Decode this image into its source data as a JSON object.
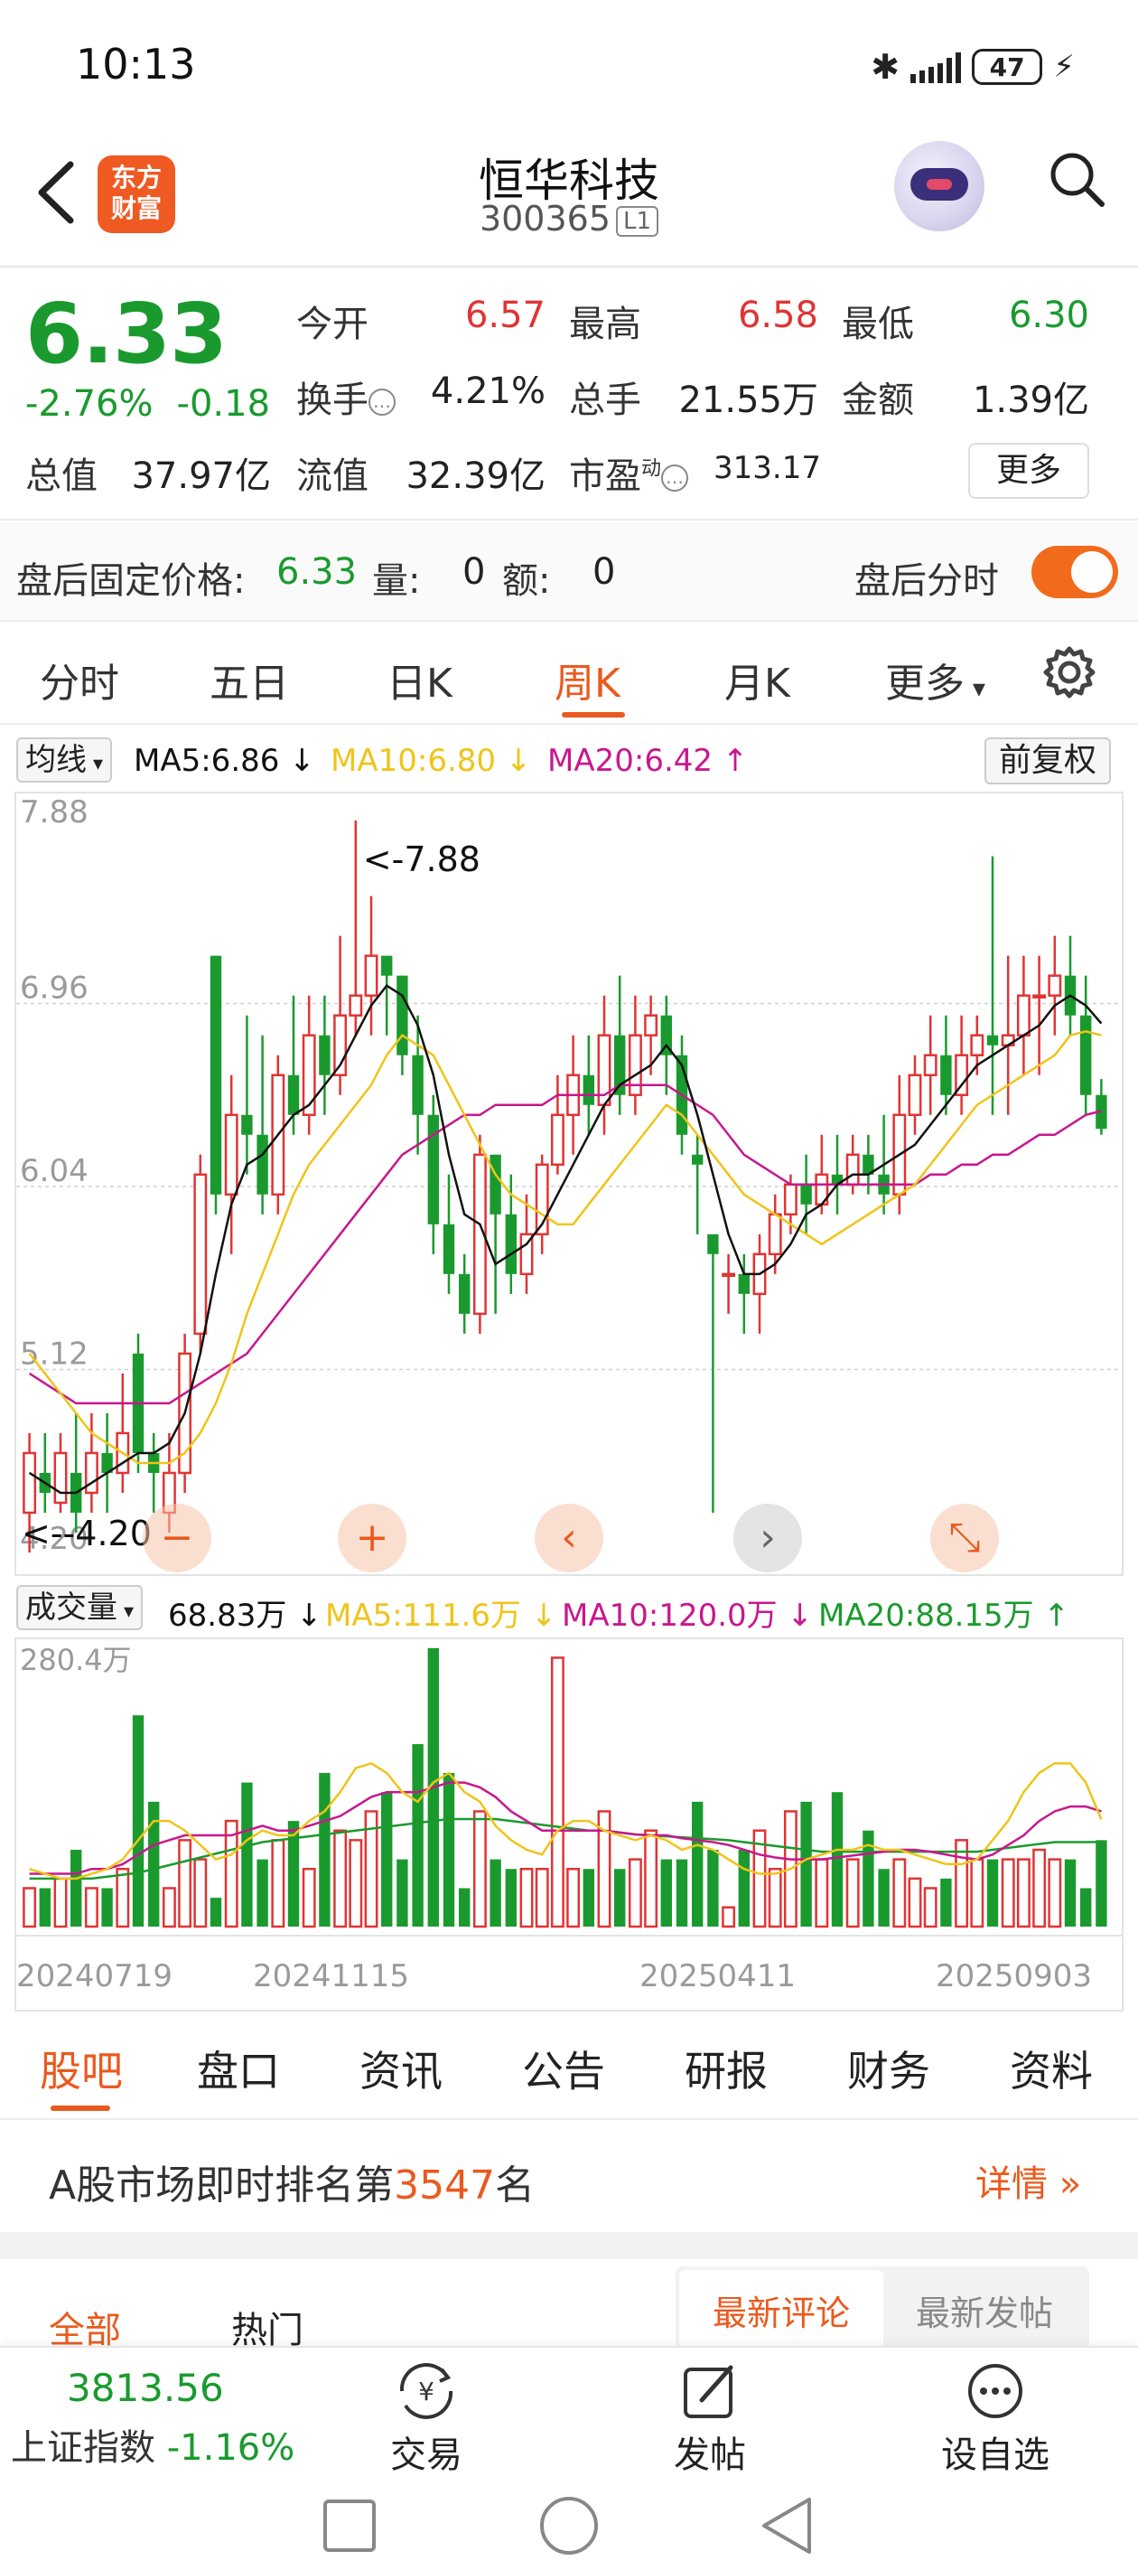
{
  "status_bar": {
    "time": "10:13",
    "battery": "47"
  },
  "header": {
    "title": "恒华科技",
    "code": "300365",
    "board_badge": "L1",
    "logo_text_line1": "东方",
    "logo_text_line2": "财富"
  },
  "quote": {
    "price": "6.33",
    "change_pct": "-2.76%",
    "change_abs": "-0.18",
    "open_label": "今开",
    "open_value": "6.57",
    "high_label": "最高",
    "high_value": "6.58",
    "low_label": "最低",
    "low_value": "6.30",
    "turnover_label": "换手",
    "turnover_value": "4.21%",
    "volume_label": "总手",
    "volume_value": "21.55万",
    "amount_label": "金额",
    "amount_value": "1.39亿",
    "mktcap_label": "总值",
    "mktcap_value": "37.97亿",
    "float_label": "流值",
    "float_value": "32.39亿",
    "pe_label": "市盈",
    "pe_sup": "动",
    "pe_value": "313.17",
    "more_button": "更多"
  },
  "after_hours": {
    "label": "盘后固定价格:",
    "price": "6.33",
    "vol_label": "量:",
    "vol_value": "0",
    "amt_label": "额:",
    "amt_value": "0",
    "toggle_label": "盘后分时",
    "toggle_on": true
  },
  "period_tabs": [
    "分时",
    "五日",
    "日K",
    "周K",
    "月K",
    "更多"
  ],
  "active_period": "周K",
  "ma_bar": {
    "selector": "均线",
    "ma5": "MA5:6.86",
    "ma10": "MA10:6.80",
    "ma20": "MA20:6.42",
    "adjust": "前复权"
  },
  "volume_bar": {
    "selector": "成交量",
    "vol": "68.83万",
    "ma5": "MA5:111.6万",
    "ma10": "MA10:120.0万",
    "ma20": "MA20:88.15万"
  },
  "colors": {
    "up": "#e03434",
    "down": "#1a9a2e",
    "ma5_line": "#111111",
    "ma10_line": "#f0c419",
    "ma20_line": "#c8178e",
    "accent": "#ea5a1e"
  },
  "chart_data": [
    {
      "type": "candlestick",
      "title": "",
      "y_ticks": [
        "7.88",
        "6.96",
        "6.04",
        "5.12",
        "4.20"
      ],
      "ylim": [
        4.2,
        7.88
      ],
      "high_marker": "<-7.88",
      "low_marker": "<--4.20",
      "candles": [
        [
          4.4,
          4.7,
          4.2,
          4.8
        ],
        [
          4.6,
          4.5,
          4.4,
          4.8
        ],
        [
          4.45,
          4.7,
          4.4,
          4.8
        ],
        [
          4.6,
          4.4,
          4.3,
          4.9
        ],
        [
          4.5,
          4.7,
          4.4,
          4.9
        ],
        [
          4.7,
          4.6,
          4.4,
          4.9
        ],
        [
          4.6,
          4.8,
          4.5,
          5.1
        ],
        [
          5.2,
          4.7,
          4.6,
          5.3
        ],
        [
          4.7,
          4.6,
          4.4,
          4.8
        ],
        [
          4.4,
          4.6,
          4.3,
          4.8
        ],
        [
          4.6,
          5.2,
          4.5,
          5.3
        ],
        [
          5.3,
          6.1,
          5.2,
          6.2
        ],
        [
          7.2,
          6.0,
          5.9,
          7.2
        ],
        [
          6.0,
          6.4,
          5.7,
          6.6
        ],
        [
          6.4,
          6.3,
          6.1,
          6.9
        ],
        [
          6.3,
          6.0,
          5.9,
          6.8
        ],
        [
          6.0,
          6.6,
          5.9,
          6.7
        ],
        [
          6.6,
          6.4,
          6.3,
          7.0
        ],
        [
          6.4,
          6.8,
          6.3,
          7.0
        ],
        [
          6.8,
          6.6,
          6.4,
          7.0
        ],
        [
          6.6,
          6.9,
          6.5,
          7.3
        ],
        [
          6.9,
          7.0,
          6.8,
          7.88
        ],
        [
          7.0,
          7.2,
          6.8,
          7.5
        ],
        [
          7.2,
          7.1,
          6.8,
          7.2
        ],
        [
          7.1,
          6.7,
          6.6,
          7.1
        ],
        [
          6.7,
          6.4,
          6.2,
          6.9
        ],
        [
          6.4,
          5.85,
          5.7,
          6.5
        ],
        [
          5.85,
          5.6,
          5.5,
          6.1
        ],
        [
          5.6,
          5.4,
          5.3,
          5.7
        ],
        [
          5.4,
          6.2,
          5.3,
          6.3
        ],
        [
          6.2,
          5.9,
          5.4,
          6.2
        ],
        [
          5.9,
          5.6,
          5.5,
          6.1
        ],
        [
          5.6,
          5.8,
          5.5,
          6.0
        ],
        [
          5.8,
          6.15,
          5.7,
          6.2
        ],
        [
          6.15,
          6.4,
          6.1,
          6.6
        ],
        [
          6.4,
          6.6,
          6.2,
          6.8
        ],
        [
          6.6,
          6.45,
          6.3,
          6.8
        ],
        [
          6.45,
          6.8,
          6.3,
          7.0
        ],
        [
          6.8,
          6.5,
          6.4,
          7.1
        ],
        [
          6.5,
          6.8,
          6.4,
          7.0
        ],
        [
          6.8,
          6.9,
          6.6,
          7.0
        ],
        [
          6.9,
          6.7,
          6.5,
          7.0
        ],
        [
          6.7,
          6.3,
          6.2,
          6.8
        ],
        [
          6.2,
          6.15,
          5.8,
          6.3
        ],
        [
          5.8,
          5.7,
          4.4,
          5.8
        ],
        [
          5.6,
          5.6,
          5.4,
          5.7
        ],
        [
          5.6,
          5.5,
          5.3,
          5.7
        ],
        [
          5.5,
          5.7,
          5.3,
          5.8
        ],
        [
          5.7,
          5.9,
          5.6,
          6.0
        ],
        [
          5.9,
          6.05,
          5.8,
          6.1
        ],
        [
          6.05,
          5.95,
          5.8,
          6.2
        ],
        [
          5.95,
          6.1,
          5.9,
          6.3
        ],
        [
          6.1,
          6.05,
          5.9,
          6.3
        ],
        [
          6.05,
          6.2,
          6.0,
          6.3
        ],
        [
          6.2,
          6.1,
          6.0,
          6.3
        ],
        [
          6.1,
          6.0,
          5.9,
          6.4
        ],
        [
          6.0,
          6.4,
          5.9,
          6.6
        ],
        [
          6.4,
          6.6,
          6.3,
          6.7
        ],
        [
          6.6,
          6.7,
          6.4,
          6.9
        ],
        [
          6.7,
          6.5,
          6.4,
          6.9
        ],
        [
          6.5,
          6.7,
          6.4,
          6.9
        ],
        [
          6.7,
          6.8,
          6.6,
          6.9
        ],
        [
          6.8,
          6.75,
          6.4,
          7.7
        ],
        [
          6.75,
          6.8,
          6.4,
          7.2
        ],
        [
          6.8,
          7.0,
          6.6,
          7.2
        ],
        [
          7.0,
          7.0,
          6.6,
          7.2
        ],
        [
          7.0,
          7.1,
          6.8,
          7.3
        ],
        [
          7.1,
          6.9,
          6.8,
          7.3
        ],
        [
          6.9,
          6.5,
          6.4,
          7.1
        ],
        [
          6.5,
          6.33,
          6.3,
          6.58
        ]
      ],
      "ma5": [
        4.6,
        4.55,
        4.5,
        4.5,
        4.55,
        4.6,
        4.65,
        4.7,
        4.7,
        4.75,
        4.9,
        5.2,
        5.6,
        5.95,
        6.15,
        6.2,
        6.3,
        6.4,
        6.45,
        6.55,
        6.65,
        6.8,
        6.95,
        7.05,
        7.0,
        6.85,
        6.6,
        6.2,
        5.9,
        5.85,
        5.65,
        5.7,
        5.75,
        5.85,
        6.0,
        6.15,
        6.3,
        6.45,
        6.55,
        6.6,
        6.65,
        6.75,
        6.65,
        6.4,
        6.1,
        5.8,
        5.6,
        5.6,
        5.65,
        5.75,
        5.9,
        5.95,
        6.05,
        6.1,
        6.1,
        6.15,
        6.2,
        6.25,
        6.35,
        6.45,
        6.55,
        6.65,
        6.7,
        6.75,
        6.8,
        6.85,
        6.95,
        7.0,
        6.95,
        6.86
      ],
      "ma10": [
        5.2,
        5.1,
        5.0,
        4.9,
        4.8,
        4.75,
        4.7,
        4.65,
        4.65,
        4.65,
        4.7,
        4.8,
        4.95,
        5.15,
        5.4,
        5.6,
        5.8,
        6.0,
        6.15,
        6.25,
        6.35,
        6.45,
        6.55,
        6.7,
        6.8,
        6.75,
        6.7,
        6.55,
        6.4,
        6.25,
        6.1,
        6.0,
        5.95,
        5.9,
        5.85,
        5.85,
        5.95,
        6.05,
        6.15,
        6.25,
        6.35,
        6.45,
        6.4,
        6.3,
        6.2,
        6.1,
        6.0,
        5.95,
        5.9,
        5.85,
        5.8,
        5.75,
        5.8,
        5.85,
        5.9,
        5.95,
        6.0,
        6.05,
        6.15,
        6.25,
        6.35,
        6.45,
        6.5,
        6.55,
        6.6,
        6.65,
        6.7,
        6.8,
        6.82,
        6.8
      ],
      "ma20": [
        5.1,
        5.05,
        5.0,
        4.95,
        4.95,
        4.95,
        4.95,
        4.95,
        4.95,
        4.95,
        5.0,
        5.05,
        5.1,
        5.15,
        5.2,
        5.3,
        5.4,
        5.5,
        5.6,
        5.7,
        5.8,
        5.9,
        6.0,
        6.1,
        6.2,
        6.25,
        6.3,
        6.35,
        6.4,
        6.4,
        6.45,
        6.45,
        6.45,
        6.45,
        6.5,
        6.5,
        6.5,
        6.5,
        6.55,
        6.55,
        6.55,
        6.55,
        6.5,
        6.45,
        6.4,
        6.3,
        6.2,
        6.15,
        6.1,
        6.05,
        6.05,
        6.05,
        6.05,
        6.05,
        6.05,
        6.05,
        6.05,
        6.05,
        6.1,
        6.1,
        6.15,
        6.15,
        6.2,
        6.2,
        6.25,
        6.3,
        6.3,
        6.35,
        6.4,
        6.42
      ]
    },
    {
      "type": "bar",
      "title": "",
      "y_max_label": "280.4万",
      "ylim": [
        0,
        280.4
      ],
      "x_labels": [
        "20240719",
        "20241115",
        "20250411",
        "20250903"
      ],
      "volumes": [
        40,
        40,
        50,
        80,
        40,
        40,
        60,
        220,
        130,
        40,
        90,
        70,
        30,
        110,
        150,
        70,
        90,
        110,
        60,
        160,
        100,
        90,
        120,
        140,
        70,
        190,
        290,
        160,
        40,
        120,
        70,
        60,
        60,
        60,
        280,
        60,
        60,
        120,
        60,
        70,
        100,
        70,
        70,
        130,
        80,
        20,
        80,
        100,
        60,
        120,
        130,
        70,
        140,
        70,
        100,
        60,
        70,
        50,
        40,
        50,
        90,
        70,
        70,
        70,
        70,
        80,
        70,
        70,
        40,
        90
      ],
      "vol_ma5": [
        60,
        55,
        50,
        50,
        55,
        60,
        70,
        90,
        110,
        110,
        100,
        85,
        70,
        75,
        90,
        100,
        95,
        95,
        110,
        120,
        140,
        165,
        170,
        160,
        140,
        130,
        150,
        160,
        140,
        130,
        105,
        90,
        80,
        75,
        100,
        110,
        110,
        100,
        95,
        90,
        95,
        90,
        80,
        85,
        80,
        70,
        60,
        55,
        55,
        60,
        70,
        75,
        80,
        80,
        85,
        80,
        80,
        75,
        70,
        65,
        65,
        70,
        90,
        110,
        140,
        160,
        170,
        170,
        150,
        111.6
      ],
      "vol_ma10": [
        55,
        55,
        55,
        55,
        60,
        60,
        65,
        75,
        85,
        90,
        95,
        95,
        95,
        95,
        100,
        105,
        100,
        100,
        105,
        110,
        115,
        125,
        135,
        140,
        140,
        140,
        145,
        150,
        150,
        145,
        135,
        120,
        110,
        100,
        100,
        100,
        100,
        100,
        98,
        96,
        95,
        95,
        92,
        90,
        88,
        85,
        80,
        75,
        72,
        70,
        70,
        70,
        72,
        74,
        76,
        78,
        80,
        80,
        78,
        75,
        72,
        70,
        75,
        85,
        95,
        110,
        120,
        125,
        125,
        120.0
      ],
      "vol_ma20": [
        50,
        50,
        50,
        50,
        50,
        52,
        54,
        56,
        60,
        64,
        68,
        72,
        76,
        80,
        84,
        88,
        90,
        92,
        94,
        96,
        98,
        100,
        102,
        104,
        106,
        108,
        110,
        112,
        112,
        112,
        112,
        110,
        108,
        106,
        104,
        102,
        100,
        100,
        98,
        96,
        95,
        94,
        93,
        92,
        91,
        90,
        88,
        86,
        84,
        82,
        80,
        78,
        78,
        78,
        78,
        78,
        78,
        78,
        78,
        78,
        78,
        78,
        80,
        82,
        84,
        86,
        88,
        88,
        88,
        88.15
      ]
    }
  ],
  "bottom_tabs": [
    "股吧",
    "盘口",
    "资讯",
    "公告",
    "研报",
    "财务",
    "资料"
  ],
  "active_bottom_tab": "股吧",
  "rank": {
    "prefix": "A股市场即时排名第",
    "number": "3547",
    "suffix": "名",
    "detail": "详情"
  },
  "comment_tabs": {
    "all": "全部",
    "hot": "热门",
    "latest_comment": "最新评论",
    "latest_post": "最新发帖"
  },
  "bottom_bar": {
    "index_value": "3813.56",
    "index_name": "上证指数",
    "index_change": "-1.16%",
    "trade": "交易",
    "post": "发帖",
    "watchlist": "设自选"
  }
}
